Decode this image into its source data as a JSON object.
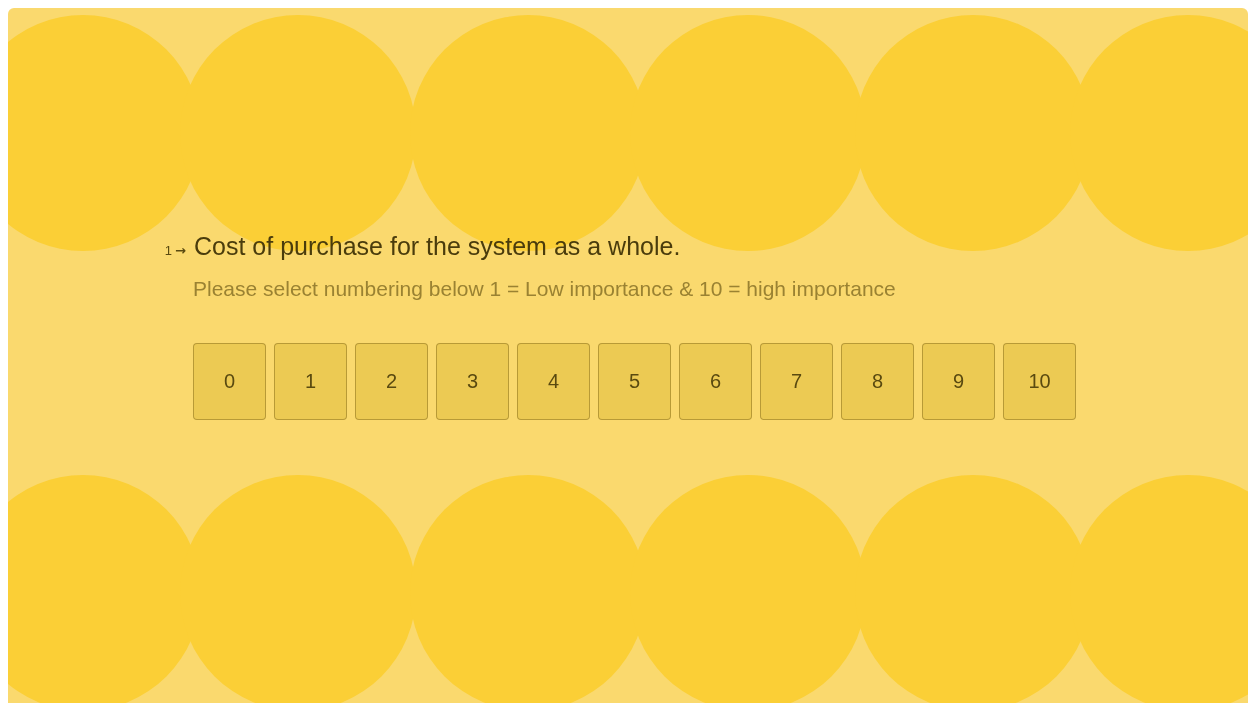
{
  "question": {
    "number": "1",
    "arrow": "→",
    "title": "Cost of purchase for the system as a whole.",
    "description": "Please select numbering below 1 = Low importance & 10 = high importance"
  },
  "scale": [
    {
      "label": "0",
      "selected": false
    },
    {
      "label": "1",
      "selected": false
    },
    {
      "label": "2",
      "selected": false
    },
    {
      "label": "3",
      "selected": false
    },
    {
      "label": "4",
      "selected": false
    },
    {
      "label": "5",
      "selected": false
    },
    {
      "label": "6",
      "selected": false
    },
    {
      "label": "7",
      "selected": false
    },
    {
      "label": "8",
      "selected": false
    },
    {
      "label": "9",
      "selected": false
    },
    {
      "label": "10",
      "selected": false
    }
  ]
}
